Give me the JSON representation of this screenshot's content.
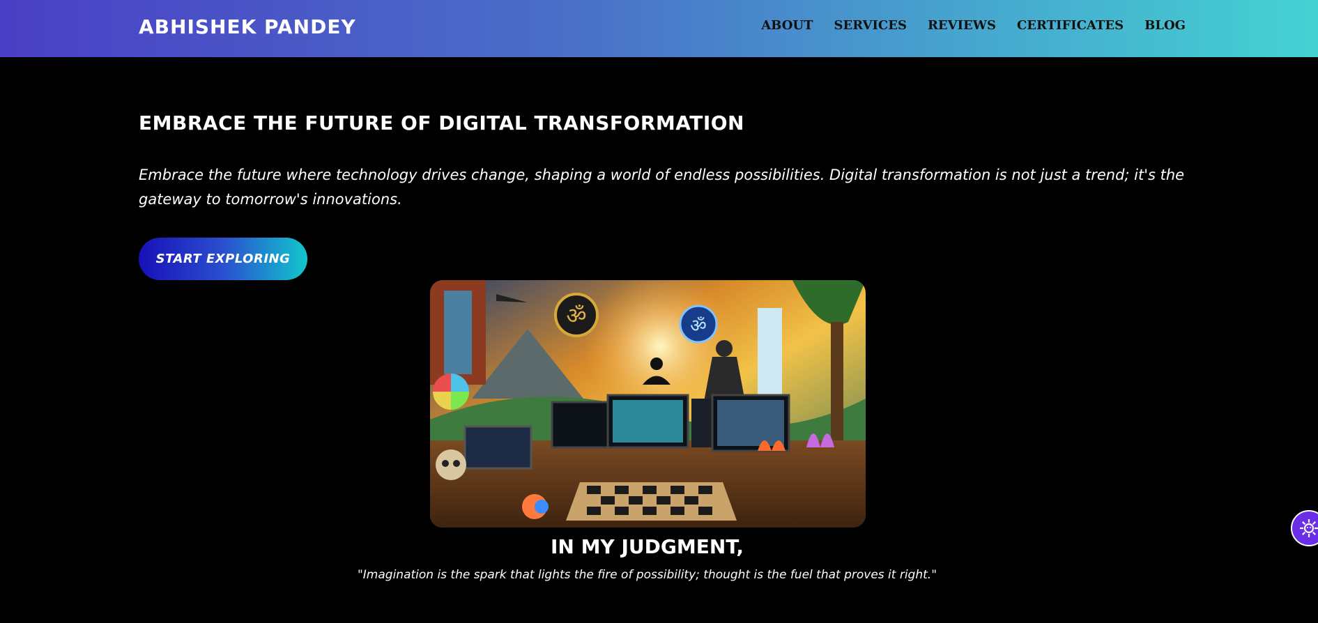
{
  "header": {
    "logo": "ABHISHEK PANDEY",
    "nav": [
      "ABOUT",
      "SERVICES",
      "REVIEWS",
      "CERTIFICATES",
      "BLOG"
    ]
  },
  "hero": {
    "title": "EMBRACE THE FUTURE OF DIGITAL TRANSFORMATION",
    "text": "Embrace the future where technology drives change, shaping a world of endless possibilities. Digital transformation is not just a trend; it's the gateway to tomorrow's innovations.",
    "button_label": "START EXPLORING"
  },
  "quote_section": {
    "heading": "IN MY JUDGMENT,",
    "quote": "\"Imagination is the spark that lights the fire of possibility; thought is the fuel that proves it right.\""
  },
  "icons": {
    "settings_fab": "gear-icon"
  },
  "colors": {
    "nav_gradient_start": "#4a3fc5",
    "nav_gradient_end": "#44d2d2",
    "button_gradient_start": "#1810b8",
    "button_gradient_end": "#11c7cd",
    "background": "#000000",
    "fab": "#6a2ee6"
  }
}
